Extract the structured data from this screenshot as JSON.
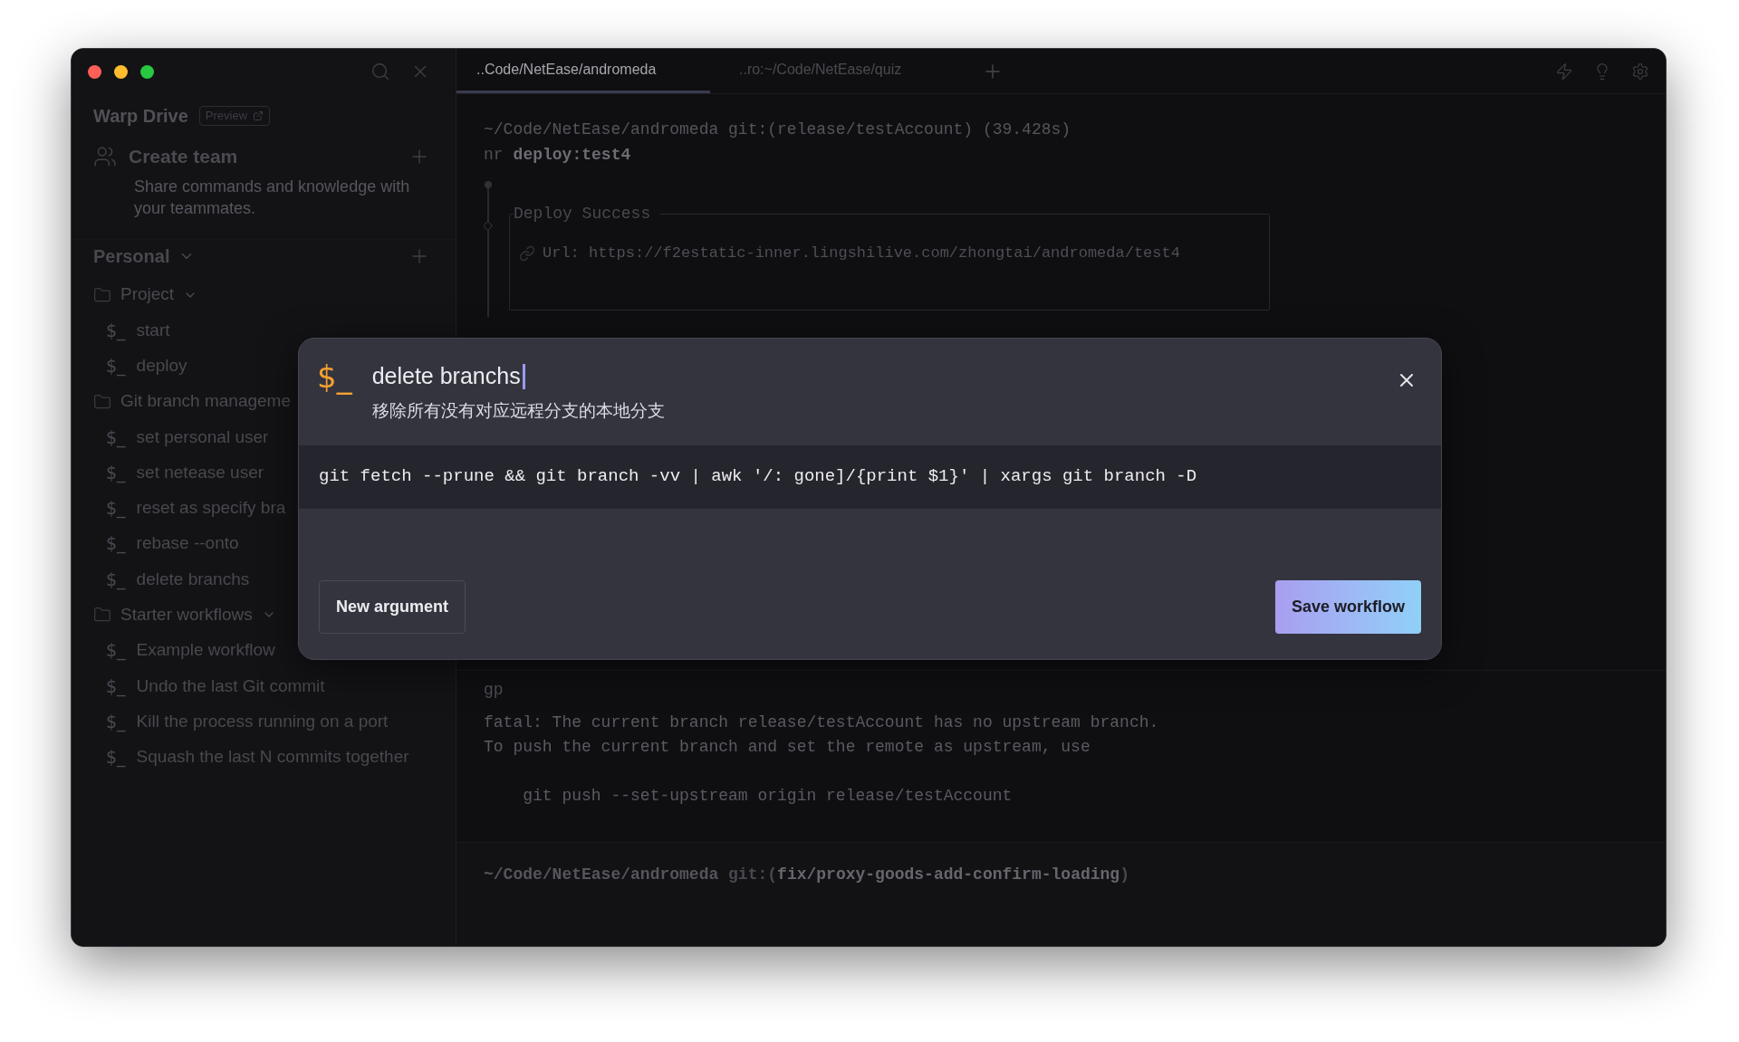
{
  "sidebar": {
    "title": "Warp Drive",
    "badge": "Preview",
    "create_team": {
      "label": "Create team",
      "description": "Share commands and knowledge with your teammates."
    },
    "section": {
      "label": "Personal",
      "expanded": true
    },
    "tree": [
      {
        "kind": "folder",
        "label": "Project",
        "expanded": true,
        "children": [
          {
            "kind": "workflow",
            "icon": "$_",
            "label": "start"
          },
          {
            "kind": "workflow",
            "icon": "$_",
            "label": "deploy"
          }
        ]
      },
      {
        "kind": "folder",
        "label": "Git branch manageme",
        "children": [
          {
            "kind": "workflow",
            "icon": "$_",
            "label": "set personal user"
          },
          {
            "kind": "workflow",
            "icon": "$_",
            "label": "set netease user"
          },
          {
            "kind": "workflow",
            "icon": "$_",
            "label": "reset as specify bra"
          },
          {
            "kind": "workflow",
            "icon": "$_",
            "label": "rebase --onto"
          },
          {
            "kind": "workflow",
            "icon": "$_",
            "label": "delete branchs"
          }
        ]
      },
      {
        "kind": "folder",
        "label": "Starter workflows",
        "expanded": true,
        "children": [
          {
            "kind": "workflow",
            "icon": "$_",
            "label": "Example workflow"
          },
          {
            "kind": "workflow",
            "icon": "$_",
            "label": "Undo the last Git commit"
          },
          {
            "kind": "workflow",
            "icon": "$_",
            "label": "Kill the process running on a port"
          },
          {
            "kind": "workflow",
            "icon": "$_",
            "label": "Squash the last N commits together"
          }
        ]
      }
    ]
  },
  "tabs": [
    {
      "label": "..Code/NetEase/andromeda",
      "selected": true
    },
    {
      "label": "..ro:~/Code/NetEase/quiz",
      "selected": false
    }
  ],
  "terminal": {
    "blocks": [
      {
        "prompt": "~/Code/NetEase/andromeda git:(release/testAccount) (39.428s)",
        "command_prefix": "nr",
        "command": "deploy:test4",
        "deploy_box": {
          "title": "Deploy Success",
          "url": "Url: https://f2estatic-inner.lingshilive.com/zhongtai/andromeda/test4"
        }
      },
      {
        "command": "gp",
        "output": [
          [
            "fatal: The current branch release/testAccount has no upstream branch.",
            "To push the current branch and set the remote as upstream, use"
          ],
          [
            "    git push --set-upstream origin release/testAccount"
          ]
        ]
      }
    ],
    "input": {
      "path": "~/Code/NetEase/andromeda",
      "git_label": "git:(",
      "branch": "fix/proxy-goods-add-confirm-loading",
      "git_close": ")"
    }
  },
  "modal": {
    "icon": "$_",
    "title": "delete branchs",
    "description": "移除所有没有对应远程分支的本地分支",
    "command": "git fetch --prune && git branch -vv | awk '/: gone]/{print $1}' | xargs git branch -D",
    "buttons": [
      {
        "label": "New argument",
        "kind": "secondary"
      },
      {
        "label": "Save workflow",
        "kind": "primary"
      }
    ]
  }
}
